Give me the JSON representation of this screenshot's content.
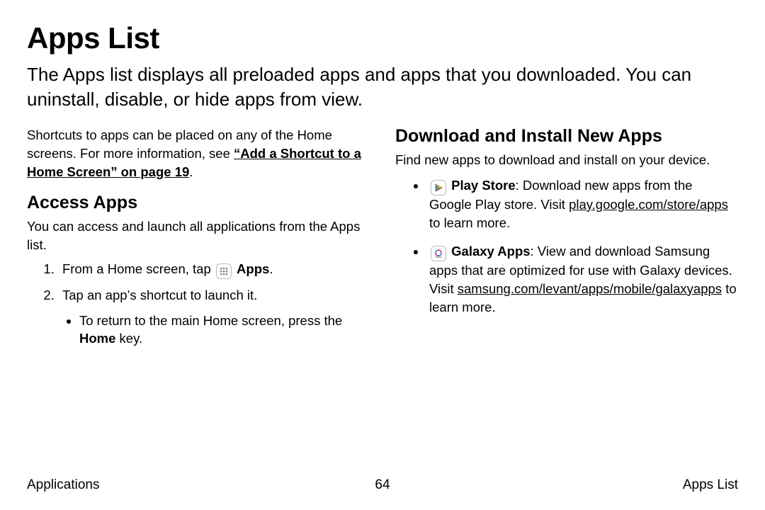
{
  "title": "Apps List",
  "intro": "The Apps list displays all preloaded apps and apps that you downloaded. You can uninstall, disable, or hide apps from view.",
  "left": {
    "shortcuts_intro": "Shortcuts to apps can be placed on any of the Home screens. For more information, see ",
    "shortcut_link": "“Add a Shortcut to a Home Screen” on page 19",
    "period": ".",
    "access_heading": "Access Apps",
    "access_intro": "You can access and launch all applications from the Apps list.",
    "step1_pre": "From a Home screen, tap ",
    "step1_bold": "Apps",
    "step1_post": ".",
    "step2": "Tap an app’s shortcut to launch it.",
    "step2_sub_pre": "To return to the main Home screen, press the ",
    "step2_sub_bold": "Home",
    "step2_sub_post": " key."
  },
  "right": {
    "heading": "Download and Install New Apps",
    "intro": "Find new apps to download and install on your device.",
    "play_bold": "Play Store",
    "play_text1": ": Download new apps from the Google Play store. Visit ",
    "play_link": "play.google.com/store/apps",
    "play_text2": " to learn more.",
    "galaxy_bold": "Galaxy Apps",
    "galaxy_text1": ": View and download Samsung apps that are optimized for use with Galaxy devices. Visit ",
    "galaxy_link": "samsung.com/levant/apps/mobile/galaxyapps",
    "galaxy_text2": " to learn more."
  },
  "footer": {
    "left": "Applications",
    "center": "64",
    "right": "Apps List"
  }
}
